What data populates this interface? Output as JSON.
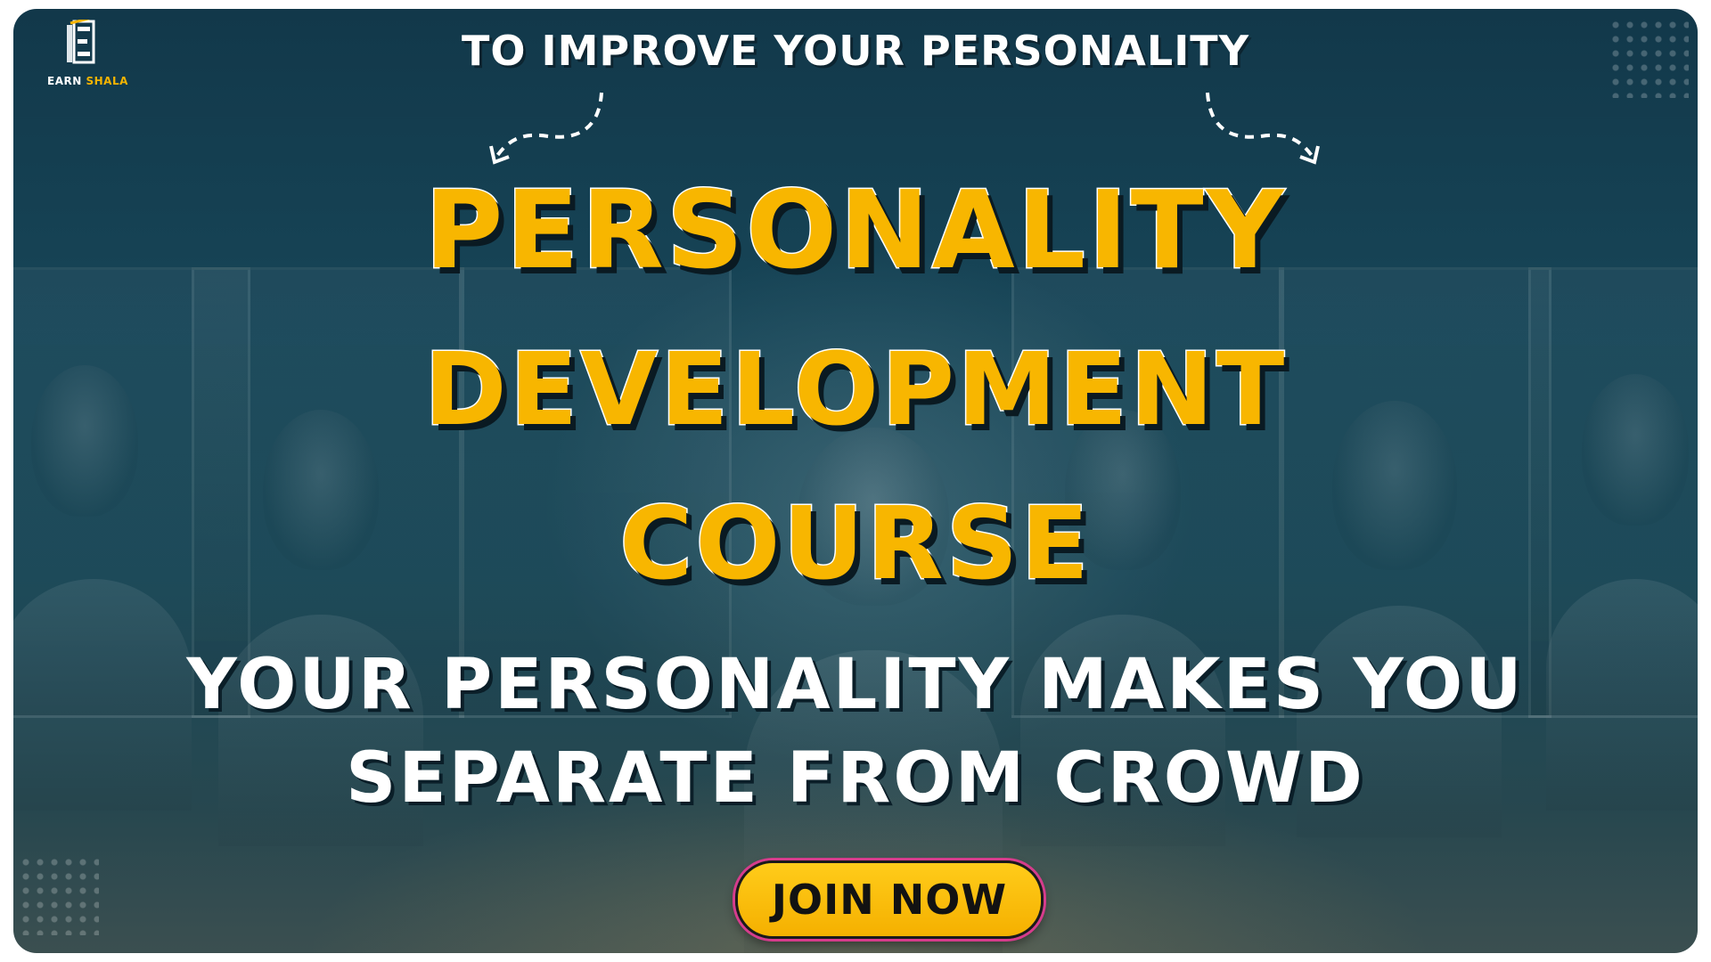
{
  "brand": {
    "name_part1": "EARN",
    "name_part2": "SHALA",
    "logo_icon": "book-e-icon",
    "accent_color": "#f5b400"
  },
  "header": {
    "tagline": "TO IMPROVE YOUR PERSONALITY",
    "left_arrow_icon": "dashed-arrow-down-left-icon",
    "right_arrow_icon": "dashed-arrow-down-right-icon"
  },
  "headline": {
    "line1": "PERSONALITY",
    "line2": "DEVELOPMENT",
    "line3": "COURSE",
    "color": "#f8b600"
  },
  "subheadline": {
    "line1": "YOUR PERSONALITY MAKES YOU",
    "line2": "SEPARATE FROM CROWD",
    "color": "#ffffff"
  },
  "cta": {
    "label": "JOIN NOW",
    "background": "#f5b000",
    "ring_color": "#d63c8c"
  },
  "background": {
    "base_color": "#174658"
  }
}
